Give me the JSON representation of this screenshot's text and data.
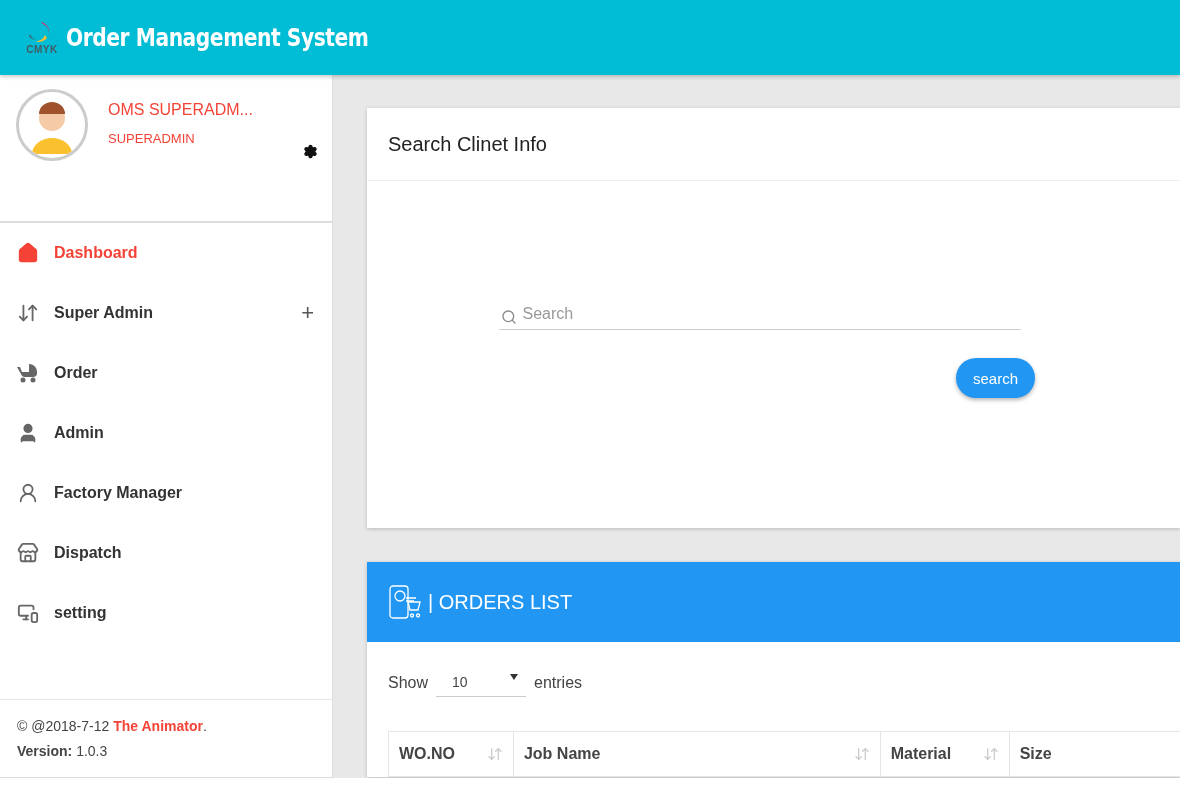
{
  "header": {
    "logo_text": "CMYK",
    "title": "Order Management System"
  },
  "profile": {
    "name": "OMS SUPERADM...",
    "role": "SUPERADMIN"
  },
  "sidebar": {
    "items": [
      {
        "label": "Dashboard",
        "selected": true
      },
      {
        "label": "Super Admin",
        "selected": false,
        "expander": "+"
      },
      {
        "label": "Order",
        "selected": false
      },
      {
        "label": "Admin",
        "selected": false
      },
      {
        "label": "Factory Manager",
        "selected": false
      },
      {
        "label": "Dispatch",
        "selected": false
      },
      {
        "label": "setting",
        "selected": false
      }
    ]
  },
  "footer": {
    "copyright": "© @2018-7-12",
    "author_link": "The Animator",
    "period": ".",
    "version": "**Version:** 1.0.3"
  },
  "search_card": {
    "title": "Search Clinet Info",
    "placeholder": "Search",
    "button": "search"
  },
  "orders_card": {
    "title": "| ORDERS LIST",
    "show_label": "Show",
    "page_size": "10",
    "entries_label": "entries",
    "columns": [
      "WO.NO",
      "Job Name",
      "Material",
      "Size"
    ]
  }
}
